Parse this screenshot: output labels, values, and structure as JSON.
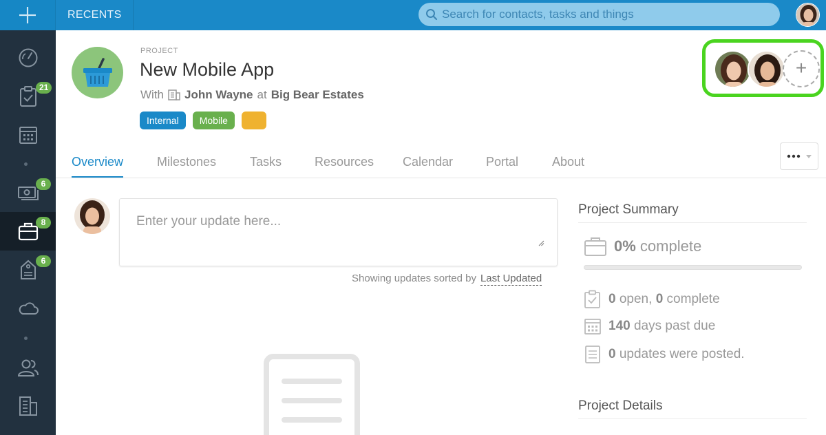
{
  "topbar": {
    "recents_label": "RECENTS",
    "search_placeholder": "Search for contacts, tasks and things"
  },
  "sidebar": {
    "items": [
      {
        "name": "dashboard",
        "icon": "gauge-icon",
        "badge": ""
      },
      {
        "name": "tasks",
        "icon": "clipboard-check-icon",
        "badge": "21"
      },
      {
        "name": "calendar",
        "icon": "calendar-icon",
        "badge": ""
      },
      {
        "name": "opportunities",
        "icon": "money-icon",
        "badge": "6"
      },
      {
        "name": "projects",
        "icon": "briefcase-icon",
        "badge": "8",
        "active": true
      },
      {
        "name": "cases",
        "icon": "tag-icon",
        "badge": "6"
      },
      {
        "name": "cloud",
        "icon": "cloud-icon",
        "badge": ""
      },
      {
        "name": "contacts",
        "icon": "people-icon",
        "badge": ""
      },
      {
        "name": "organizations",
        "icon": "building-icon",
        "badge": ""
      }
    ]
  },
  "project": {
    "label": "PROJECT",
    "title": "New Mobile App",
    "with_prefix": "With",
    "contact": "John Wayne",
    "at_word": "at",
    "organization": "Big Bear Estates",
    "tags": [
      {
        "label": "Internal",
        "color": "#1a89c8"
      },
      {
        "label": "Mobile",
        "color": "#69b04d"
      },
      {
        "label": "",
        "color": "#efb230"
      }
    ],
    "add_follower_symbol": "+"
  },
  "tabs": [
    {
      "label": "Overview",
      "active": true
    },
    {
      "label": "Milestones"
    },
    {
      "label": "Tasks"
    },
    {
      "label": "Resources"
    },
    {
      "label": "Calendar"
    },
    {
      "label": "Portal"
    },
    {
      "label": "About"
    }
  ],
  "feed": {
    "update_placeholder": "Enter your update here...",
    "sort_prefix": "Showing updates sorted by",
    "sort_value": "Last Updated"
  },
  "summary": {
    "title": "Project Summary",
    "percent": "0%",
    "complete_word": "complete",
    "progress": 0,
    "open_count": "0",
    "open_word": "open,",
    "complete_count": "0",
    "complete_label": "complete",
    "days": "140",
    "days_label": "days past due",
    "updates_count": "0",
    "updates_label": "updates were posted."
  },
  "details": {
    "title": "Project Details"
  },
  "colors": {
    "brand": "#1a89c8",
    "sidebar": "#22313f",
    "badge": "#69b04d",
    "highlight": "#4ad41f",
    "project_icon_bg": "#8cc57b"
  }
}
